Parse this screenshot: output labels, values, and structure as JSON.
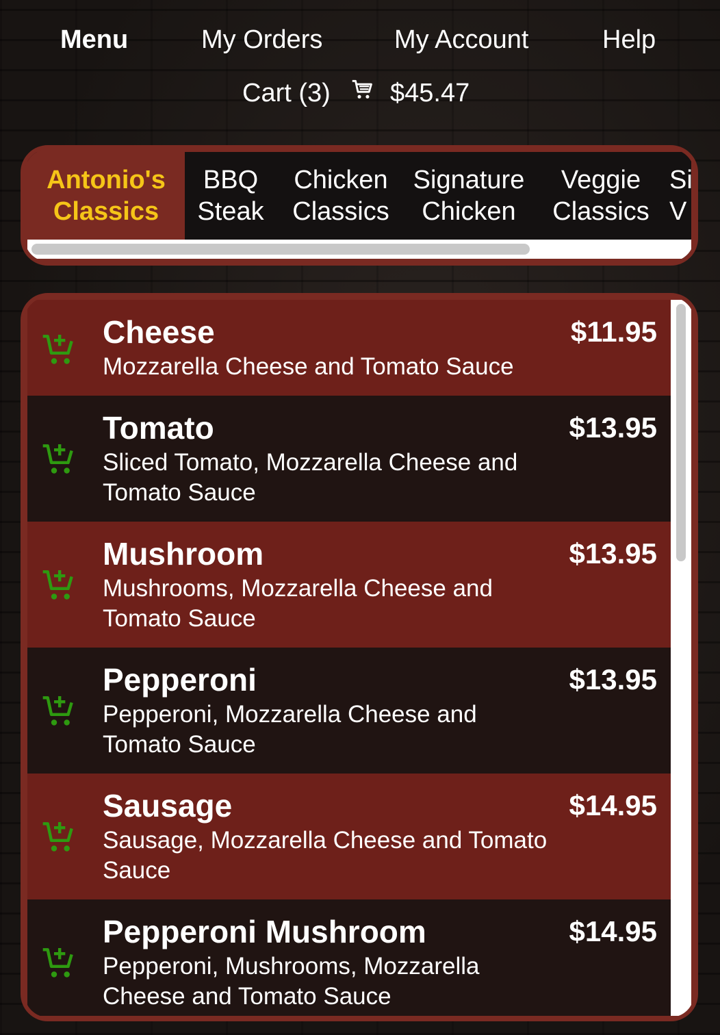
{
  "nav": {
    "menu": "Menu",
    "orders": "My Orders",
    "account": "My Account",
    "help": "Help"
  },
  "cart": {
    "label": "Cart (3)",
    "icon": "shopping-cart-icon",
    "total": "$45.47"
  },
  "categories": [
    {
      "line1": "Antonio's",
      "line2": "Classics",
      "active": true
    },
    {
      "line1": "BBQ",
      "line2": "Steak",
      "active": false
    },
    {
      "line1": "Chicken",
      "line2": "Classics",
      "active": false
    },
    {
      "line1": "Signature",
      "line2": "Chicken",
      "active": false
    },
    {
      "line1": "Veggie",
      "line2": "Classics",
      "active": false
    },
    {
      "line1": "Si",
      "line2": "V",
      "active": false
    }
  ],
  "menu_items": [
    {
      "name": "Cheese",
      "description": "Mozzarella Cheese and Tomato Sauce",
      "price": "$11.95"
    },
    {
      "name": "Tomato",
      "description": "Sliced Tomato, Mozzarella Cheese and Tomato Sauce",
      "price": "$13.95"
    },
    {
      "name": "Mushroom",
      "description": "Mushrooms, Mozzarella Cheese and Tomato Sauce",
      "price": "$13.95"
    },
    {
      "name": "Pepperoni",
      "description": "Pepperoni, Mozzarella Cheese and Tomato Sauce",
      "price": "$13.95"
    },
    {
      "name": "Sausage",
      "description": "Sausage, Mozzarella Cheese and Tomato Sauce",
      "price": "$14.95"
    },
    {
      "name": "Pepperoni Mushroom",
      "description": "Pepperoni, Mushrooms, Mozzarella Cheese and Tomato Sauce",
      "price": "$14.95"
    }
  ],
  "colors": {
    "brand_red": "#7a2a22",
    "active_tab_text": "#f5c518",
    "add_to_cart_green": "#2e9a10"
  },
  "icons": {
    "add_to_cart": "add-to-cart-icon"
  }
}
